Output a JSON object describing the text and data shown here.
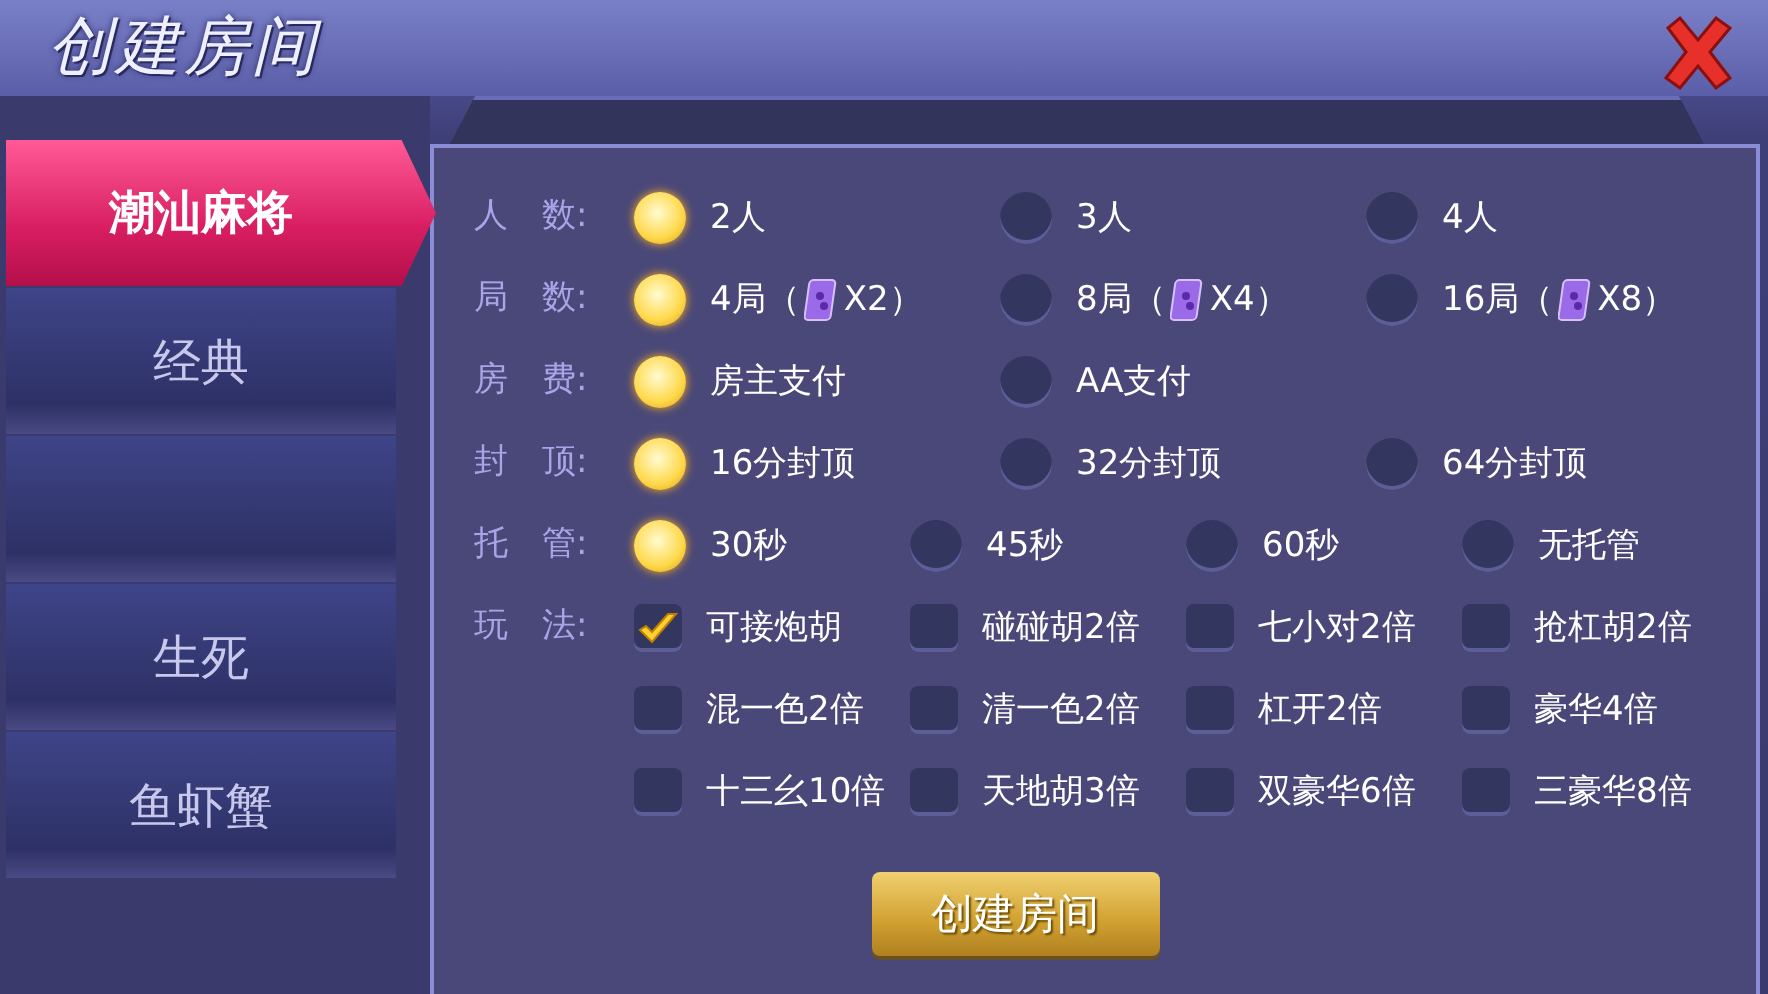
{
  "window": {
    "title": "创建房间"
  },
  "sidebar": {
    "items": [
      {
        "label": "潮汕麻将",
        "selected": true
      },
      {
        "label": "经典",
        "selected": false
      },
      {
        "selected": false
      },
      {
        "label": "生死",
        "selected": false
      },
      {
        "label": "鱼虾蟹",
        "selected": false
      }
    ]
  },
  "options": [
    {
      "label": "人　数:",
      "kind": "radio",
      "items": [
        {
          "text": "2人",
          "selected": true
        },
        {
          "text": "3人",
          "selected": false
        },
        {
          "text": "4人",
          "selected": false
        }
      ]
    },
    {
      "label": "局　数:",
      "kind": "radio",
      "items": [
        {
          "text": "4局（",
          "after_card": "X2）",
          "selected": true
        },
        {
          "text": "8局（",
          "after_card": "X4）",
          "selected": false
        },
        {
          "text": "16局（",
          "after_card": "X8）",
          "selected": false
        }
      ]
    },
    {
      "label": "房　费:",
      "kind": "radio",
      "items": [
        {
          "text": "房主支付",
          "selected": true
        },
        {
          "text": "AA支付",
          "selected": false
        }
      ]
    },
    {
      "label": "封　顶:",
      "kind": "radio",
      "items": [
        {
          "text": "16分封顶",
          "selected": true
        },
        {
          "text": "32分封顶",
          "selected": false
        },
        {
          "text": "64分封顶",
          "selected": false
        }
      ]
    },
    {
      "label": "托　管:",
      "kind": "radio",
      "items": [
        {
          "text": "30秒",
          "selected": true
        },
        {
          "text": "45秒",
          "selected": false
        },
        {
          "text": "60秒",
          "selected": false
        },
        {
          "text": "无托管",
          "selected": false
        }
      ]
    },
    {
      "label": "玩　法:",
      "kind": "check",
      "items": [
        {
          "text": "可接炮胡",
          "checked": true
        },
        {
          "text": "碰碰胡2倍",
          "checked": false
        },
        {
          "text": "七小对2倍",
          "checked": false
        },
        {
          "text": "抢杠胡2倍",
          "checked": false
        },
        {
          "text": "混一色2倍",
          "checked": false
        },
        {
          "text": "清一色2倍",
          "checked": false
        },
        {
          "text": "杠开2倍",
          "checked": false
        },
        {
          "text": "豪华4倍",
          "checked": false
        },
        {
          "text": "十三幺10倍",
          "checked": false
        },
        {
          "text": "天地胡3倍",
          "checked": false
        },
        {
          "text": "双豪华6倍",
          "checked": false
        },
        {
          "text": "三豪华8倍",
          "checked": false
        }
      ]
    }
  ],
  "create_button": "创建房间"
}
